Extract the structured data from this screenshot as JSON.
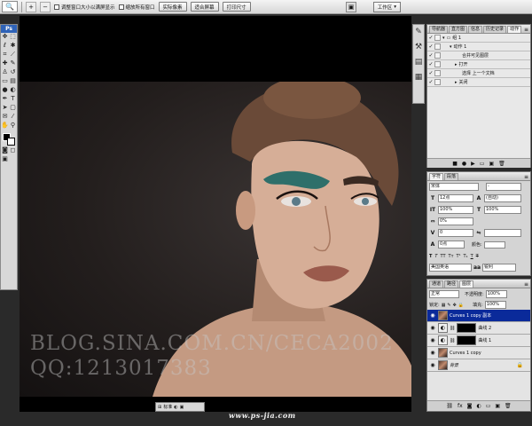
{
  "options_bar": {
    "resize_window_label": "调整窗口大小以满屏显示",
    "zoom_all_windows_label": "缩放所有窗口",
    "buttons": [
      "实际像素",
      "适合屏幕",
      "打印尺寸"
    ],
    "workspace_label": "工作区"
  },
  "toolbox": {
    "logo": "Ps"
  },
  "watermark": {
    "line1": "BLOG.SINA.COM.CN/CECA2002",
    "line2": "QQ:1213017383"
  },
  "actions_panel": {
    "tabs": [
      "导航器",
      "直方图",
      "信息",
      "历史记录",
      "动作"
    ],
    "rows": [
      {
        "check": "✓",
        "label": "组 1",
        "indent": 0,
        "icon": "folder-icon"
      },
      {
        "check": "✓",
        "label": "动作 1",
        "indent": 1,
        "icon": "triangle-down-icon"
      },
      {
        "check": "✓",
        "label": "合并可见图层",
        "indent": 3,
        "icon": ""
      },
      {
        "check": "✓",
        "label": "打开",
        "indent": 2,
        "icon": "triangle-right-icon"
      },
      {
        "check": "✓",
        "label": "选择 上一个文档",
        "indent": 3,
        "icon": ""
      },
      {
        "check": "✓",
        "label": "关闭",
        "indent": 2,
        "icon": "triangle-right-icon"
      }
    ]
  },
  "character_panel": {
    "tabs": [
      "字符",
      "段落"
    ],
    "font_family": "宋体",
    "font_style": "-",
    "font_size": "12点",
    "leading": "(自动)",
    "vertical_scale": "100%",
    "horizontal_scale": "100%",
    "tracking": "0%",
    "kerning": "0",
    "baseline_shift": "0点",
    "color_label": "颜色:",
    "language": "美国英语",
    "antialias": "锐利"
  },
  "layers_panel": {
    "tabs": [
      "通道",
      "路径",
      "图层"
    ],
    "blend_mode": "正常",
    "opacity_label": "不透明度:",
    "opacity": "100%",
    "lock_label": "锁定:",
    "fill_label": "填充:",
    "fill": "100%",
    "layers": [
      {
        "name": "Curves 1 copy 副本",
        "type": "photo",
        "selected": true
      },
      {
        "name": "曲线 2",
        "type": "adjustment",
        "selected": false
      },
      {
        "name": "曲线 1",
        "type": "adjustment",
        "selected": false
      },
      {
        "name": "Curves 1 copy",
        "type": "photo",
        "selected": false
      },
      {
        "name": "背景",
        "type": "photo",
        "selected": false,
        "locked": true
      }
    ]
  },
  "status": {
    "label": "标准",
    "site_credit": "www.ps-jia.com"
  },
  "colors": {
    "selected_layer": "#0a2a9a",
    "panel_bg": "#d4d4d4",
    "canvas_bg": "#000000"
  }
}
